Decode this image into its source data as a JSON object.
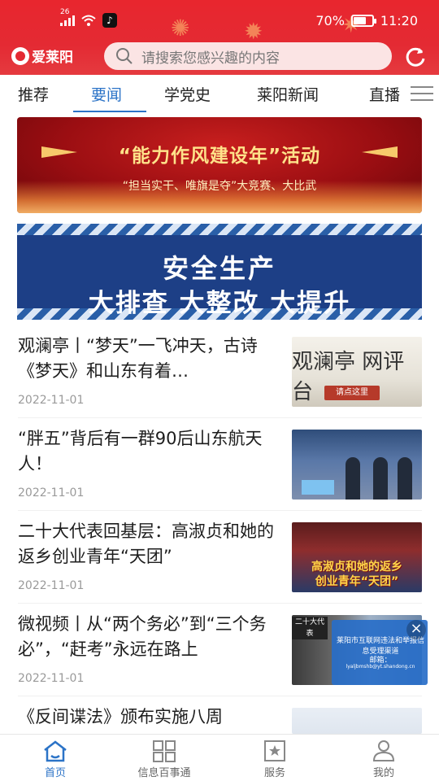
{
  "status_bar": {
    "network": "26",
    "battery_text": "70%",
    "battery_level": 0.7,
    "time": "11:20"
  },
  "header": {
    "logo_text": "爱莱阳",
    "search_placeholder": "请搜索您感兴趣的内容",
    "search_icon": "search-icon",
    "refresh_icon": "refresh-icon"
  },
  "tabs": [
    {
      "label": "推荐",
      "active": false
    },
    {
      "label": "要闻",
      "active": true
    },
    {
      "label": "学党史",
      "active": false
    },
    {
      "label": "莱阳新闻",
      "active": false
    },
    {
      "label": "直播",
      "active": false
    }
  ],
  "banners": [
    {
      "title": "“能力作风建设年”活动",
      "subtitle": "“担当实干、唯旗是夺”大竞赛、大比武"
    },
    {
      "line1": "安全生产",
      "line2": "大排查 大整改 大提升"
    }
  ],
  "news": [
    {
      "title": "观澜亭丨“梦天”一飞冲天，古诗《梦天》和山东有着…",
      "date": "2022-11-01",
      "thumb_text": "观澜亭 网评台",
      "thumb_button": "请点这里"
    },
    {
      "title": "“胖五”背后有一群90后山东航天人！",
      "date": "2022-11-01"
    },
    {
      "title": "二十大代表回基层：高淑贞和她的返乡创业青年“天团”",
      "date": "2022-11-01",
      "thumb_caption_1": "高淑贞和她的返乡",
      "thumb_caption_2": "创业青年“天团”"
    },
    {
      "title": "微视频丨从“两个务必”到“三个务必”，“赶考”永远在路上",
      "date": "2022-11-01",
      "thumb_tag": "二十大代表"
    },
    {
      "title": "《反间谍法》颁布实施八周",
      "date": ""
    }
  ],
  "float_ad": {
    "line1": "莱阳市互联网违法和举报信息受理渠道",
    "line2": "邮箱：",
    "line3": "lyaljbmshb@yt.shandong.cn",
    "close": "×"
  },
  "bottom_nav": [
    {
      "label": "首页",
      "icon": "home-icon",
      "active": true
    },
    {
      "label": "信息百事通",
      "icon": "grid-icon",
      "active": false
    },
    {
      "label": "服务",
      "icon": "star-bookmark-icon",
      "active": false
    },
    {
      "label": "我的",
      "icon": "user-icon",
      "active": false
    }
  ],
  "colors": {
    "header_red": "#e42a33",
    "accent_blue": "#2b73c7",
    "date_gray": "#9a9a9a"
  }
}
